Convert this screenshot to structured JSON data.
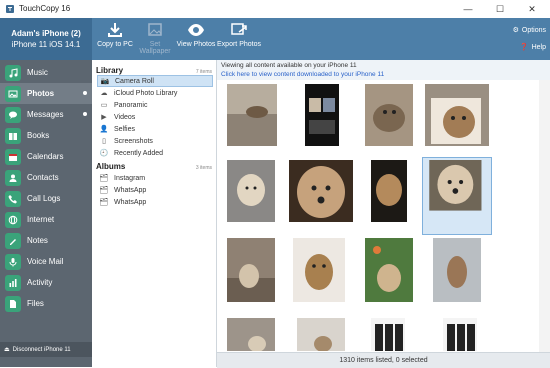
{
  "window": {
    "title": "TouchCopy 16",
    "min": "—",
    "max": "☐",
    "close": "✕"
  },
  "device": {
    "name": "Adam's iPhone (2)",
    "model": "iPhone 11 iOS 14.1"
  },
  "toolbar": {
    "copy_to_pc": "Copy to PC",
    "set_wallpaper": "Set Wallpaper",
    "view_photos": "View Photos",
    "export_photos": "Export Photos",
    "options": "Options",
    "help": "Help"
  },
  "sidebar": {
    "items": [
      {
        "label": "Music",
        "icon": "music-icon",
        "color": "#2f9b72"
      },
      {
        "label": "Photos",
        "icon": "photos-icon",
        "color": "#2f9b72",
        "active": true
      },
      {
        "label": "Messages",
        "icon": "messages-icon",
        "color": "#2f9b72",
        "dot": true
      },
      {
        "label": "Books",
        "icon": "books-icon",
        "color": "#2f9b72"
      },
      {
        "label": "Calendars",
        "icon": "calendar-icon",
        "color": "#2f9b72"
      },
      {
        "label": "Contacts",
        "icon": "contacts-icon",
        "color": "#2f9b72"
      },
      {
        "label": "Call Logs",
        "icon": "phone-icon",
        "color": "#2f9b72"
      },
      {
        "label": "Internet",
        "icon": "globe-icon",
        "color": "#2f9b72"
      },
      {
        "label": "Notes",
        "icon": "notes-icon",
        "color": "#2f9b72"
      },
      {
        "label": "Voice Mail",
        "icon": "voicemail-icon",
        "color": "#2f9b72"
      },
      {
        "label": "Activity",
        "icon": "activity-icon",
        "color": "#2f9b72"
      },
      {
        "label": "Files",
        "icon": "files-icon",
        "color": "#2f9b72"
      }
    ],
    "disconnect": "Disconnect iPhone 11"
  },
  "library": {
    "heading": "Library",
    "count": "7 items",
    "items": [
      {
        "label": "Camera Roll",
        "icon": "camera-icon",
        "selected": true
      },
      {
        "label": "iCloud Photo Library",
        "icon": "cloud-icon"
      },
      {
        "label": "Panoramic",
        "icon": "panorama-icon"
      },
      {
        "label": "Videos",
        "icon": "video-icon"
      },
      {
        "label": "Selfies",
        "icon": "selfie-icon"
      },
      {
        "label": "Screenshots",
        "icon": "screenshot-icon"
      },
      {
        "label": "Recently Added",
        "icon": "clock-icon"
      }
    ],
    "albums_heading": "Albums",
    "albums_count": "3 items",
    "albums": [
      {
        "label": "Instagram",
        "icon": "album-icon"
      },
      {
        "label": "WhatsApp",
        "icon": "album-icon"
      },
      {
        "label": "WhatsApp",
        "icon": "album-icon"
      }
    ]
  },
  "main": {
    "banner_line1": "Viewing all content available on your iPhone 11",
    "banner_line2": "Click here to view content downloaded to your iPhone 11",
    "status": "1310 items listed, 0 selected"
  },
  "colors": {
    "accent": "#4d7fa8",
    "sidebar": "#5c6670",
    "icon_green": "#2f9b72",
    "link": "#2a62c9"
  }
}
